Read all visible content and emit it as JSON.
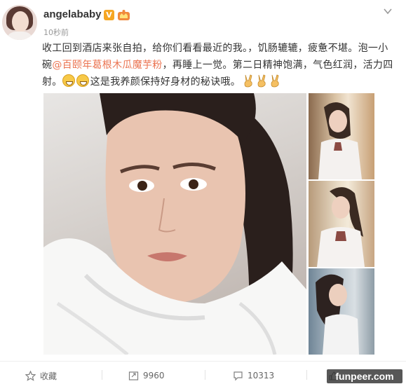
{
  "post": {
    "username": "angelababy",
    "verified_badge": "V",
    "timestamp": "10秒前",
    "text_1": "收工回到酒店来张自拍，给你们看看最近的我。，饥肠辘辘，疲惫不堪。泡一小碗",
    "mention": "@百颐年葛根木瓜魔芋粉",
    "text_2": "，再睡上一觉。第二日精神饱满，气色红润，活力四射。",
    "text_3": "这是我养颜保持好身材的秘诀哦。",
    "emoji_grin": "grinning-face-icon",
    "emoji_victory": "victory-hand-icon"
  },
  "actions": {
    "favorite_label": "收藏",
    "repost_count": "9960",
    "comment_count": "10313",
    "like_count": ""
  },
  "watermark": "funpeer.com",
  "colors": {
    "mention": "#eb7350",
    "verified": "#f6a623",
    "text": "#333333",
    "muted": "#999999"
  }
}
